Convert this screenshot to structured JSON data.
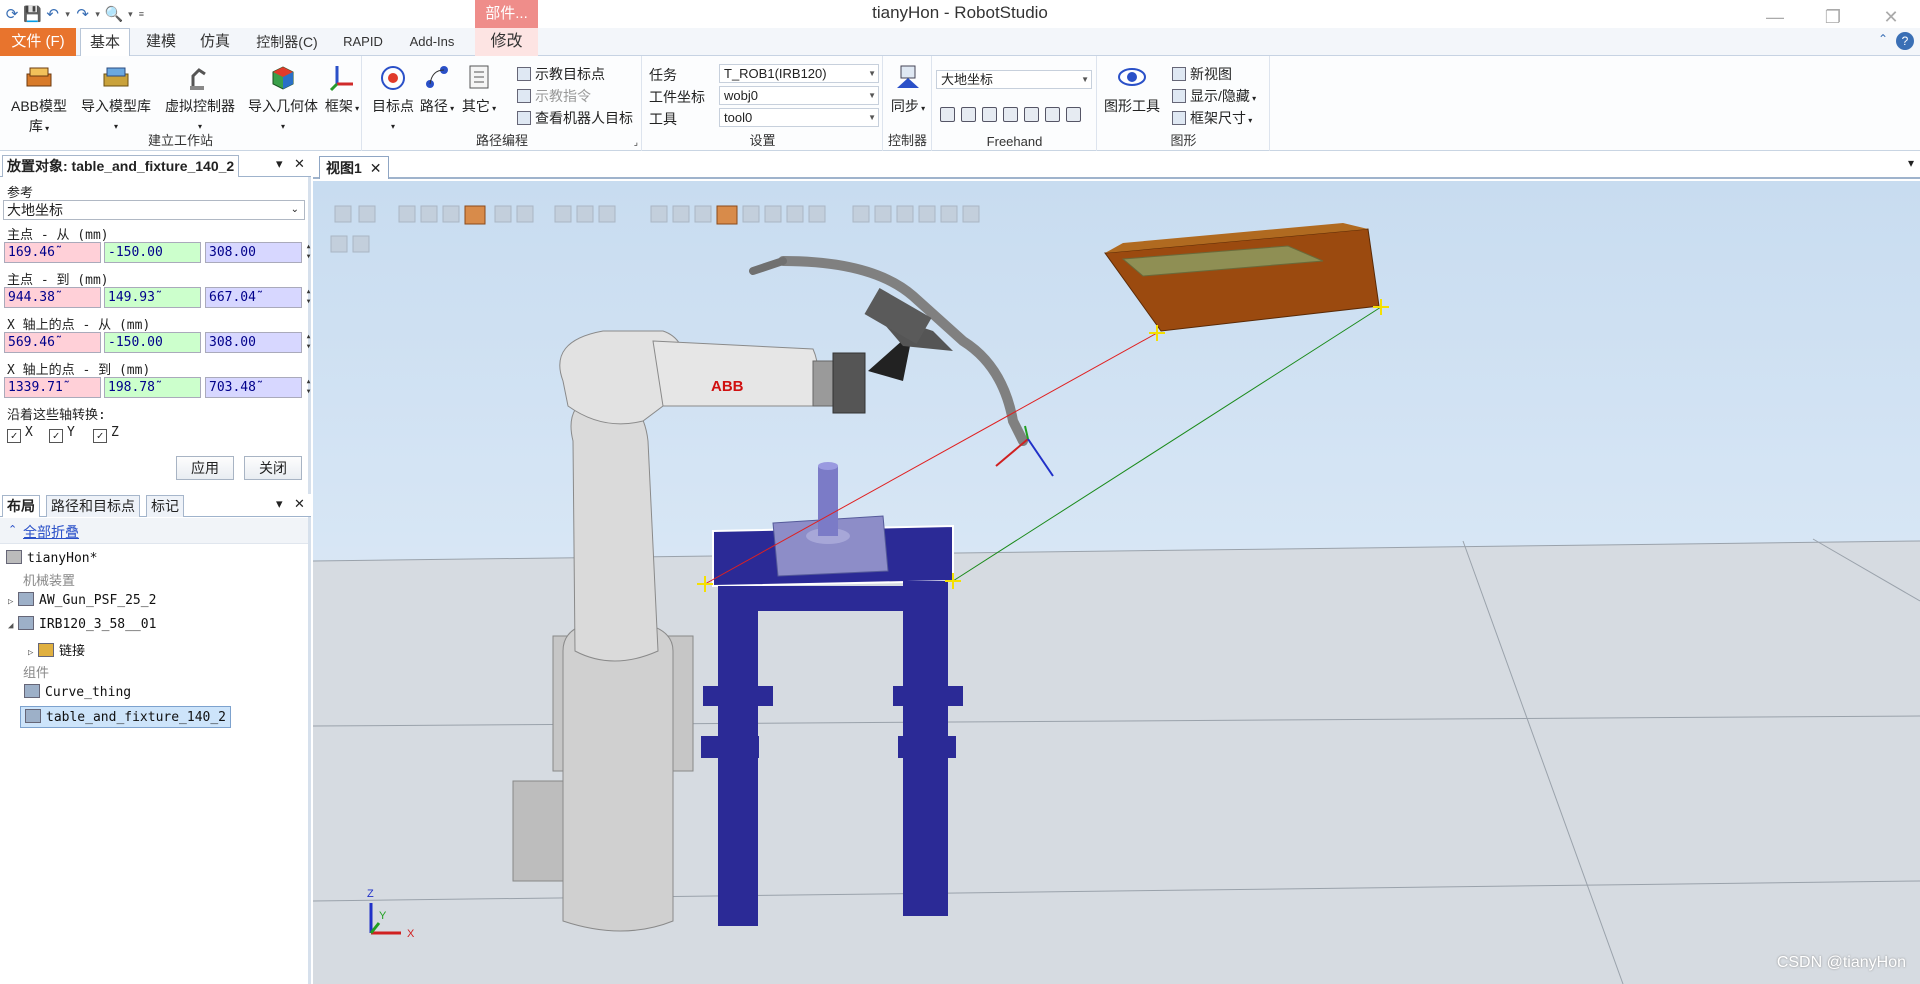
{
  "window": {
    "title": "tianyHon - RobotStudio",
    "context_tab_group": "部件..."
  },
  "tabs": [
    {
      "label": "文件 (F)"
    },
    {
      "label": "基本"
    },
    {
      "label": "建模"
    },
    {
      "label": "仿真"
    },
    {
      "label": "控制器(C)"
    },
    {
      "label": "RAPID"
    },
    {
      "label": "Add-Ins"
    },
    {
      "label": "修改"
    }
  ],
  "ribbon": {
    "build_station": {
      "label": "建立工作站",
      "buttons": [
        "ABB模型库",
        "导入模型库",
        "虚拟控制器",
        "导入几何体",
        "框架"
      ]
    },
    "path_programming": {
      "label": "路径编程",
      "buttons": [
        "目标点",
        "路径",
        "其它"
      ],
      "small": [
        "示教目标点",
        "示教指令",
        "查看机器人目标"
      ]
    },
    "settings": {
      "label": "设置",
      "task_label": "任务",
      "task_value": "T_ROB1(IRB120)",
      "wobj_label": "工件坐标",
      "wobj_value": "wobj0",
      "tool_label": "工具",
      "tool_value": "tool0"
    },
    "controller": {
      "label": "控制器",
      "sync": "同步"
    },
    "freehand": {
      "label": "Freehand",
      "frame_value": "大地坐标"
    },
    "graphics": {
      "label": "图形",
      "tools": "图形工具",
      "small": [
        "新视图",
        "显示/隐藏",
        "框架尺寸"
      ]
    }
  },
  "placement_panel": {
    "title": "放置对象: table_and_fixture_140_2",
    "reference_label": "参考",
    "reference_value": "大地坐标",
    "p1_from_label": "主点 - 从 (mm)",
    "p1_from": [
      "169.46˜",
      "-150.00",
      "308.00"
    ],
    "p1_to_label": "主点 - 到 (mm)",
    "p1_to": [
      "944.38˜",
      "149.93˜",
      "667.04˜"
    ],
    "x_from_label": "X 轴上的点 - 从 (mm)",
    "x_from": [
      "569.46˜",
      "-150.00",
      "308.00"
    ],
    "x_to_label": "X 轴上的点 - 到 (mm)",
    "x_to": [
      "1339.71˜",
      "198.78˜",
      "703.48˜"
    ],
    "convert_label": "沿着这些轴转换:",
    "axes": [
      "X",
      "Y",
      "Z"
    ],
    "apply": "应用",
    "close": "关闭"
  },
  "layout_panel": {
    "tabs": [
      "布局",
      "路径和目标点",
      "标记"
    ],
    "collapse_all": "全部折叠",
    "station": "tianyHon*",
    "mechanisms_label": "机械装置",
    "mechanisms": [
      "AW_Gun_PSF_25_2",
      "IRB120_3_58__01"
    ],
    "links": "链接",
    "components_label": "组件",
    "components": [
      "Curve_thing",
      "table_and_fixture_140_2"
    ]
  },
  "view": {
    "tab": "视图1",
    "brand_on_robot": "ABB",
    "axis_x": "X",
    "axis_y": "Y",
    "axis_z": "Z"
  },
  "watermark": "CSDN @tianyHon",
  "colors": {
    "file_tab": "#e8742d",
    "context_tab": "#ef8d8a",
    "table": "#2b2a96",
    "fixture_block": "#9b4a0f",
    "line_red": "#e02020",
    "line_green": "#1a8a1a"
  }
}
